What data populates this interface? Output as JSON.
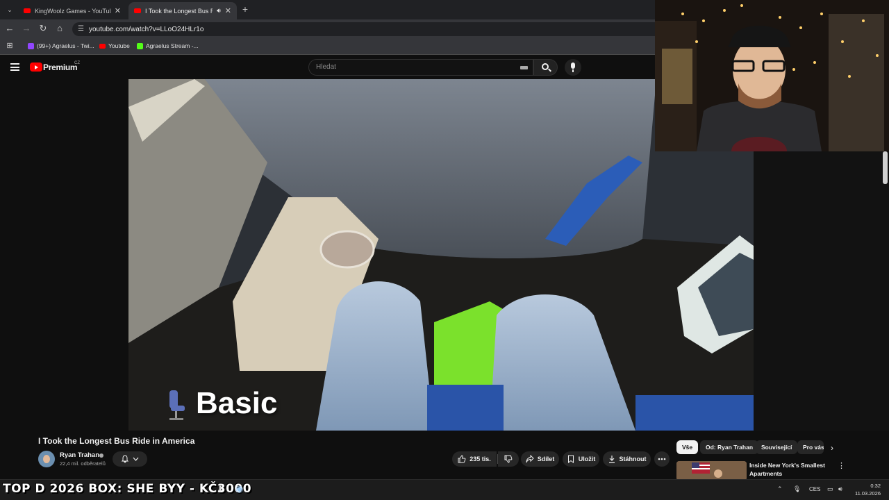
{
  "browser": {
    "tabs": [
      {
        "title": "KingWoolz Games - YouTube",
        "active": false
      },
      {
        "title": "I Took the Longest Bus Ride in America",
        "active": true
      }
    ],
    "new_tab_label": "+",
    "url": "youtube.com/watch?v=LLoO24HLr1o",
    "bookmarks": [
      {
        "label": "(99+) Agraelus - Twi...",
        "icon": "twitch-icon",
        "color": "#9146ff"
      },
      {
        "label": "Youtube",
        "icon": "youtube-icon",
        "color": "#ff0000"
      },
      {
        "label": "Agraelus Stream -...",
        "icon": "kick-icon",
        "color": "#53fc18"
      }
    ]
  },
  "youtube": {
    "logo_text": "Premium",
    "country_code": "CZ",
    "search_placeholder": "Hledat",
    "accent_color": "#ff0000"
  },
  "video": {
    "caption": "Basic",
    "caption_emoji": "seat-icon",
    "title": "I Took the Longest Bus Ride in America",
    "channel": {
      "name": "Ryan Trahan",
      "subscribers": "22,4 mil. odběratelů"
    },
    "actions": {
      "like_count": "235 tis.",
      "share_label": "Sdílet",
      "save_label": "Uložit",
      "download_label": "Stáhnout"
    }
  },
  "sidebar": {
    "chips": [
      "Vše",
      "Od: Ryan Trahan",
      "Související",
      "Pro vás"
    ],
    "recommendation": {
      "title": "Inside New York's Smallest Apartments"
    }
  },
  "taskbar": {
    "ticker": "TOP D 2026 BOX: SHE  BYY - KČ3000",
    "language": "CES",
    "time": "0:32",
    "date": "11.03.2026"
  }
}
